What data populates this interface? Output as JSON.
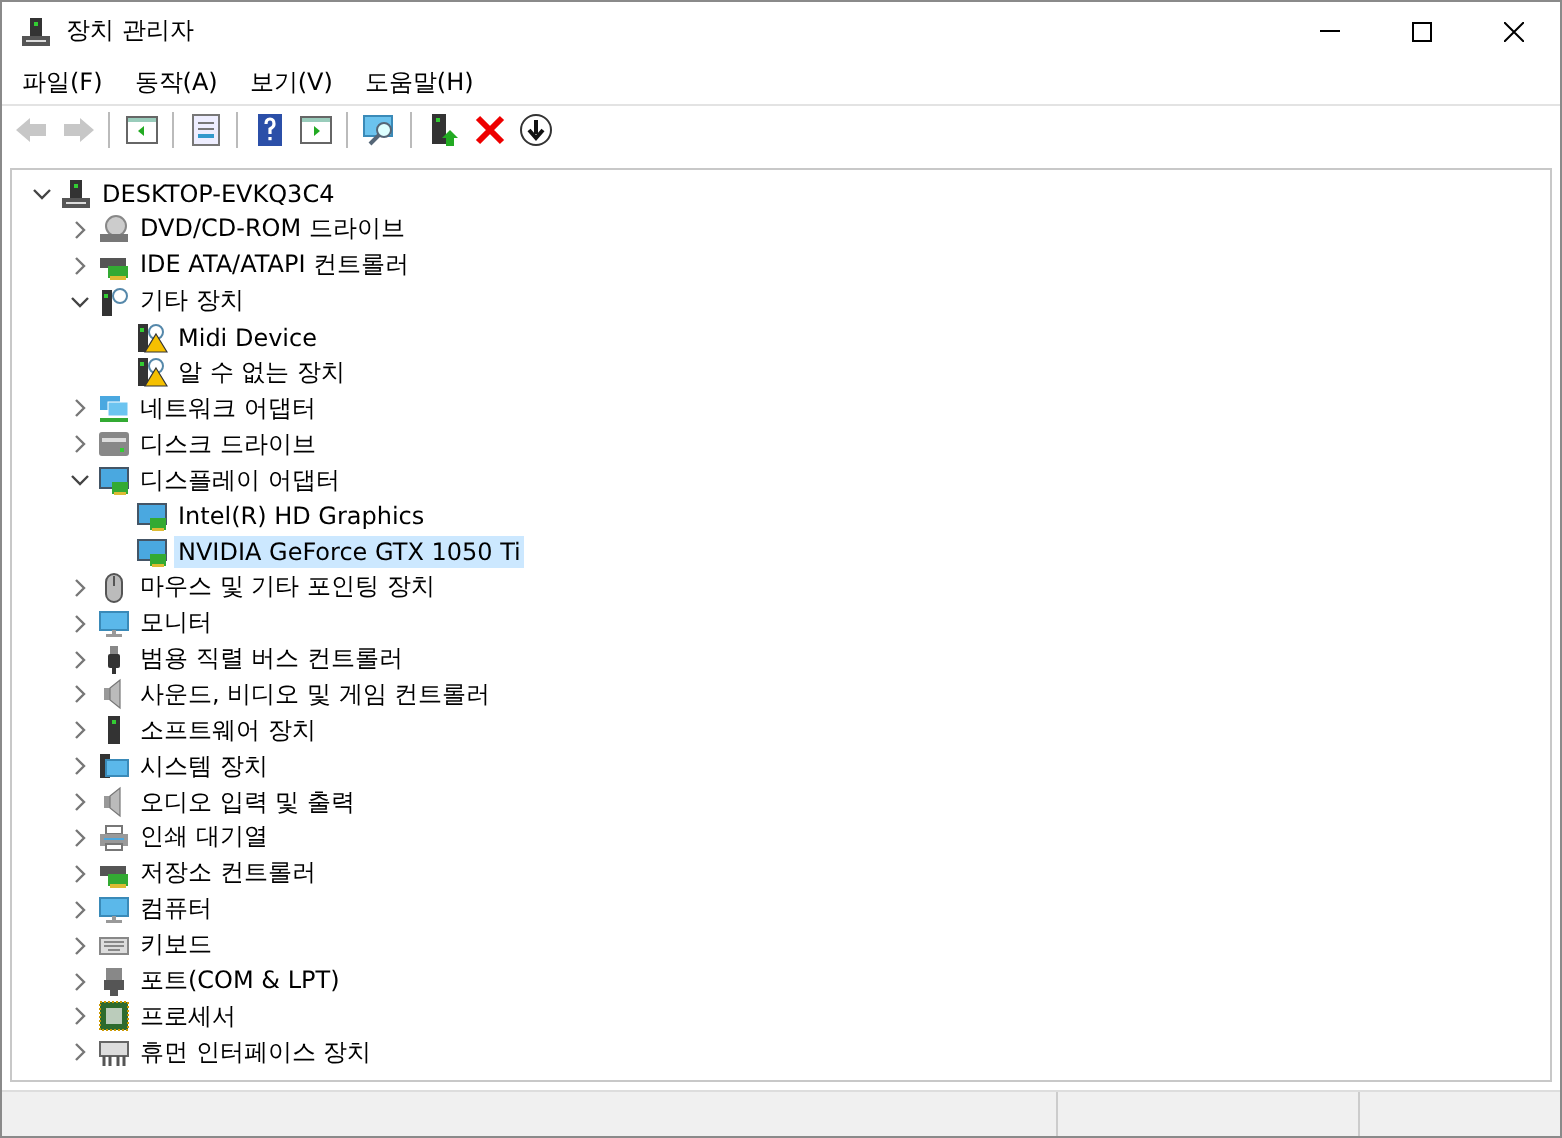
{
  "window": {
    "title": "장치 관리자"
  },
  "menu": [
    {
      "label": "파일(F)"
    },
    {
      "label": "동작(A)"
    },
    {
      "label": "보기(V)"
    },
    {
      "label": "도움말(H)"
    }
  ],
  "toolbar": [
    {
      "disabled": true
    },
    {
      "disabled": true
    },
    {
      "disabled": false
    },
    {
      "disabled": false
    },
    {
      "disabled": false
    },
    {
      "disabled": false
    },
    {
      "disabled": false
    },
    {
      "disabled": false
    },
    {
      "disabled": false
    },
    {
      "disabled": false
    }
  ],
  "tree": {
    "label": "DESKTOP-EVKQ3C4",
    "expanded": true,
    "selected": false,
    "children": [
      {
        "label": "DVD/CD-ROM 드라이브",
        "expanded": false,
        "selected": false
      },
      {
        "label": "IDE ATA/ATAPI 컨트롤러",
        "expanded": false,
        "selected": false
      },
      {
        "label": "기타 장치",
        "expanded": true,
        "selected": false,
        "children": [
          {
            "label": "Midi Device",
            "warning": true,
            "selected": false
          },
          {
            "label": "알 수 없는 장치",
            "warning": true,
            "selected": false
          }
        ]
      },
      {
        "label": "네트워크 어댑터",
        "expanded": false,
        "selected": false
      },
      {
        "label": "디스크 드라이브",
        "expanded": false,
        "selected": false
      },
      {
        "label": "디스플레이 어댑터",
        "expanded": true,
        "selected": false,
        "children": [
          {
            "label": "Intel(R) HD Graphics",
            "warning": false,
            "selected": false
          },
          {
            "label": "NVIDIA GeForce GTX 1050 Ti",
            "warning": false,
            "selected": true
          }
        ]
      },
      {
        "label": "마우스 및 기타 포인팅 장치",
        "expanded": false,
        "selected": false
      },
      {
        "label": "모니터",
        "expanded": false,
        "selected": false
      },
      {
        "label": "범용 직렬 버스 컨트롤러",
        "expanded": false,
        "selected": false
      },
      {
        "label": "사운드, 비디오 및 게임 컨트롤러",
        "expanded": false,
        "selected": false
      },
      {
        "label": "소프트웨어 장치",
        "expanded": false,
        "selected": false
      },
      {
        "label": "시스템 장치",
        "expanded": false,
        "selected": false
      },
      {
        "label": "오디오 입력 및 출력",
        "expanded": false,
        "selected": false
      },
      {
        "label": "인쇄 대기열",
        "expanded": false,
        "selected": false
      },
      {
        "label": "저장소 컨트롤러",
        "expanded": false,
        "selected": false
      },
      {
        "label": "컴퓨터",
        "expanded": false,
        "selected": false
      },
      {
        "label": "키보드",
        "expanded": false,
        "selected": false
      },
      {
        "label": "포트(COM & LPT)",
        "expanded": false,
        "selected": false
      },
      {
        "label": "프로세서",
        "expanded": false,
        "selected": false
      },
      {
        "label": "휴먼 인터페이스 장치",
        "expanded": false,
        "selected": false
      }
    ]
  }
}
